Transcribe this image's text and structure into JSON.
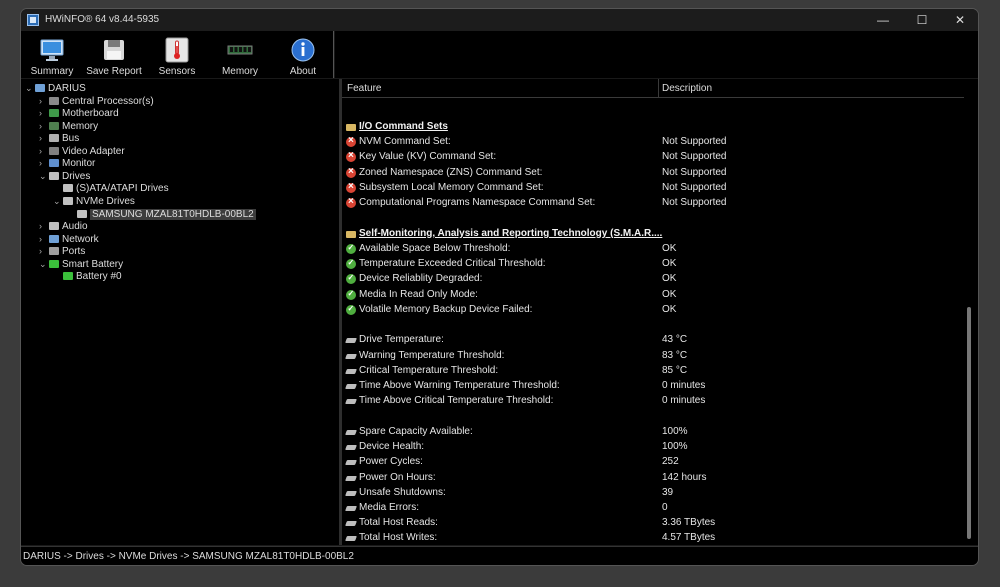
{
  "window": {
    "title": "HWiNFO® 64 v8.44-5935",
    "buttons": [
      "—",
      "☐",
      "✕"
    ]
  },
  "toolbar": [
    {
      "label": "Summary",
      "icon": "monitor-icon"
    },
    {
      "label": "Save Report",
      "icon": "floppy-disk-icon"
    },
    {
      "label": "Sensors",
      "icon": "thermometer-icon"
    },
    {
      "label": "Memory",
      "icon": "memory-module-icon"
    },
    {
      "label": "About",
      "icon": "info-icon"
    }
  ],
  "tree": [
    {
      "label": "DARIUS",
      "level": 0,
      "expanded": true,
      "icon": "computer-icon",
      "color": "#6fa0d6"
    },
    {
      "label": "Central Processor(s)",
      "level": 1,
      "expanded": false,
      "icon": "cpu-icon",
      "color": "#8a8a8a"
    },
    {
      "label": "Motherboard",
      "level": 1,
      "expanded": false,
      "icon": "motherboard-icon",
      "color": "#3f9a4a"
    },
    {
      "label": "Memory",
      "level": 1,
      "expanded": false,
      "icon": "memory-icon",
      "color": "#4f7f4f"
    },
    {
      "label": "Bus",
      "level": 1,
      "expanded": false,
      "icon": "bus-icon",
      "color": "#b0b0b0"
    },
    {
      "label": "Video Adapter",
      "level": 1,
      "expanded": false,
      "icon": "video-adapter-icon",
      "color": "#808080"
    },
    {
      "label": "Monitor",
      "level": 1,
      "expanded": false,
      "icon": "monitor-icon",
      "color": "#5f8fcf"
    },
    {
      "label": "Drives",
      "level": 1,
      "expanded": true,
      "icon": "drives-icon",
      "color": "#c0c0c0"
    },
    {
      "label": "(S)ATA/ATAPI Drives",
      "level": 2,
      "expanded": null,
      "icon": "drive-icon",
      "color": "#c0c0c0"
    },
    {
      "label": "NVMe Drives",
      "level": 2,
      "expanded": true,
      "icon": "drive-icon",
      "color": "#c0c0c0"
    },
    {
      "label": "SAMSUNG MZAL81T0HDLB-00BL2",
      "level": 3,
      "expanded": null,
      "icon": "drive-icon",
      "color": "#c0c0c0",
      "selected": true
    },
    {
      "label": "Audio",
      "level": 1,
      "expanded": false,
      "icon": "speaker-icon",
      "color": "#c0c0c0"
    },
    {
      "label": "Network",
      "level": 1,
      "expanded": false,
      "icon": "network-icon",
      "color": "#6fa0d6"
    },
    {
      "label": "Ports",
      "level": 1,
      "expanded": false,
      "icon": "ports-icon",
      "color": "#a0a0a0"
    },
    {
      "label": "Smart Battery",
      "level": 1,
      "expanded": true,
      "icon": "battery-icon",
      "color": "#3bbf3b"
    },
    {
      "label": "Battery #0",
      "level": 2,
      "expanded": null,
      "icon": "battery-icon",
      "color": "#3bbf3b"
    }
  ],
  "table": {
    "columns": [
      "Feature",
      "Description"
    ],
    "rows": [
      {
        "type": "head",
        "icon": "folder-icon",
        "feature": "I/O Command Sets",
        "desc": ""
      },
      {
        "type": "item",
        "icon": "x-icon",
        "feature": "NVM Command Set:",
        "desc": "Not Supported"
      },
      {
        "type": "item",
        "icon": "x-icon",
        "feature": "Key Value (KV) Command Set:",
        "desc": "Not Supported"
      },
      {
        "type": "item",
        "icon": "x-icon",
        "feature": "Zoned Namespace (ZNS) Command Set:",
        "desc": "Not Supported"
      },
      {
        "type": "item",
        "icon": "x-icon",
        "feature": "Subsystem Local Memory Command Set:",
        "desc": "Not Supported"
      },
      {
        "type": "item",
        "icon": "x-icon",
        "feature": "Computational Programs Namespace Command Set:",
        "desc": "Not Supported"
      },
      {
        "type": "blank"
      },
      {
        "type": "head",
        "icon": "folder-icon",
        "feature": "Self-Monitoring, Analysis and Reporting Technology (S.M.A.R....",
        "desc": ""
      },
      {
        "type": "item",
        "icon": "check-icon",
        "feature": "Available Space Below Threshold:",
        "desc": "OK"
      },
      {
        "type": "item",
        "icon": "check-icon",
        "feature": "Temperature Exceeded Critical Threshold:",
        "desc": "OK"
      },
      {
        "type": "item",
        "icon": "check-icon",
        "feature": "Device Reliablity Degraded:",
        "desc": "OK"
      },
      {
        "type": "item",
        "icon": "check-icon",
        "feature": "Media In Read Only Mode:",
        "desc": "OK"
      },
      {
        "type": "item",
        "icon": "check-icon",
        "feature": "Volatile Memory Backup Device Failed:",
        "desc": "OK"
      },
      {
        "type": "blank"
      },
      {
        "type": "item",
        "icon": "drive-icon",
        "feature": "Drive Temperature:",
        "desc": "43 °C"
      },
      {
        "type": "item",
        "icon": "drive-icon",
        "feature": "Warning Temperature Threshold:",
        "desc": "83 °C"
      },
      {
        "type": "item",
        "icon": "drive-icon",
        "feature": "Critical Temperature Threshold:",
        "desc": "85 °C"
      },
      {
        "type": "item",
        "icon": "drive-icon",
        "feature": "Time Above Warning Temperature Threshold:",
        "desc": "0 minutes"
      },
      {
        "type": "item",
        "icon": "drive-icon",
        "feature": "Time Above Critical Temperature Threshold:",
        "desc": "0 minutes"
      },
      {
        "type": "blank"
      },
      {
        "type": "item",
        "icon": "drive-icon",
        "feature": "Spare Capacity Available:",
        "desc": "100%"
      },
      {
        "type": "item",
        "icon": "drive-icon",
        "feature": "Device Health:",
        "desc": "100%"
      },
      {
        "type": "item",
        "icon": "drive-icon",
        "feature": "Power Cycles:",
        "desc": "252"
      },
      {
        "type": "item",
        "icon": "drive-icon",
        "feature": "Power On Hours:",
        "desc": "142 hours"
      },
      {
        "type": "item",
        "icon": "drive-icon",
        "feature": "Unsafe Shutdowns:",
        "desc": "39"
      },
      {
        "type": "item",
        "icon": "drive-icon",
        "feature": "Media Errors:",
        "desc": "0"
      },
      {
        "type": "item",
        "icon": "drive-icon",
        "feature": "Total Host Reads:",
        "desc": "3.36 TBytes"
      },
      {
        "type": "item",
        "icon": "drive-icon",
        "feature": "Total Host Writes:",
        "desc": "4.57 TBytes"
      }
    ]
  },
  "status": {
    "path": "DARIUS -> Drives -> NVMe Drives -> SAMSUNG MZAL81T0HDLB-00BL2"
  }
}
